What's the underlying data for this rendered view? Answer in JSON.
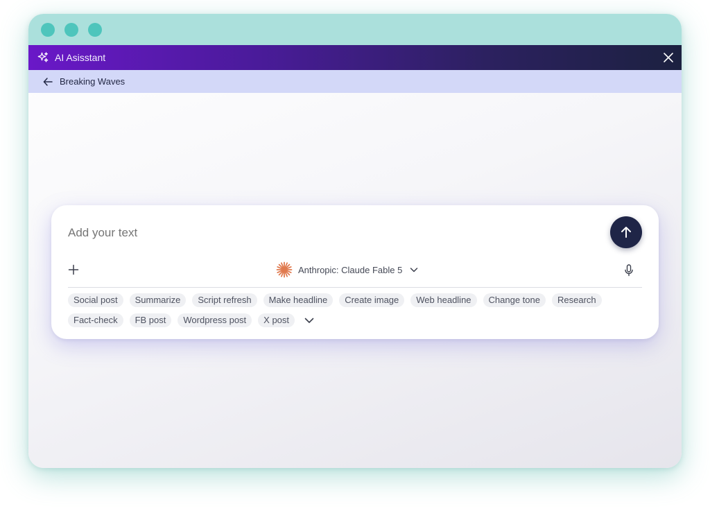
{
  "window": {
    "controls": [
      "window-dot-1",
      "window-dot-2",
      "window-dot-3"
    ]
  },
  "header": {
    "icon": "sparkle-icon",
    "title": "AI Asisstant",
    "close_icon": "close-icon"
  },
  "breadcrumb": {
    "icon": "arrow-left-icon",
    "label": "Breaking Waves"
  },
  "composer": {
    "placeholder": "Add your text",
    "send_icon": "arrow-up-icon",
    "add_icon": "plus-icon",
    "mic_icon": "microphone-icon",
    "model": {
      "logo_icon": "anthropic-starburst-icon",
      "label": "Anthropic: Claude Fable 5",
      "dropdown_icon": "chevron-down-icon"
    },
    "chips": [
      "Social post",
      "Summarize",
      "Script refresh",
      "Make headline",
      "Create image",
      "Web headline",
      "Change tone",
      "Research",
      "Fact-check",
      "FB post",
      "Wordpress post",
      "X post"
    ],
    "more_icon": "chevron-down-icon"
  },
  "colors": {
    "titlebar": "#abe0dc",
    "window_dot": "#4ec5bc",
    "header_start": "#6a18c8",
    "header_end": "#1c2140",
    "breadcrumb_bar": "#d3d8f8",
    "send_button": "#1f2547",
    "model_logo": "#e07a4f"
  }
}
